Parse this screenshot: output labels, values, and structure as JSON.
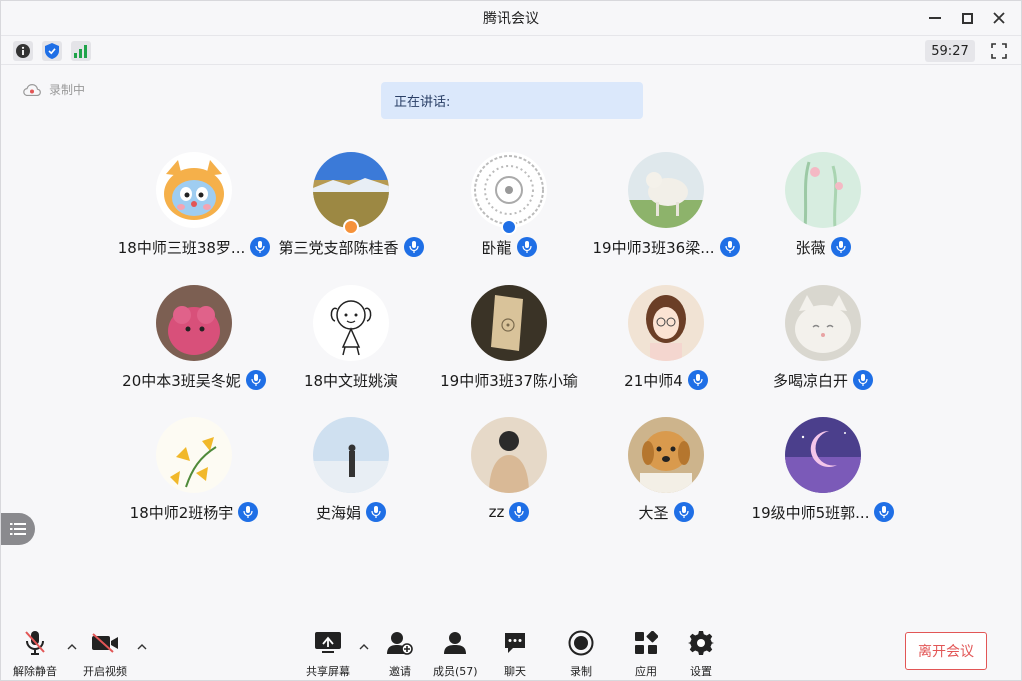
{
  "window": {
    "title": "腾讯会议"
  },
  "status": {
    "timer": "59:27",
    "icons": [
      "info-icon",
      "shield-icon",
      "signal-icon",
      "fullscreen-icon"
    ]
  },
  "recording": {
    "label": "录制中"
  },
  "speaking": {
    "label": "正在讲话:"
  },
  "participants": [
    {
      "name": "18中师三班38罗...",
      "host": false
    },
    {
      "name": "第三党支部陈桂香",
      "host": true,
      "badge_color": "#f6923a"
    },
    {
      "name": "卧龍",
      "host": true,
      "badge_color": "#1f6fe6"
    },
    {
      "name": "19中师3班36梁...",
      "host": false
    },
    {
      "name": "张薇",
      "host": false
    },
    {
      "name": "20中本3班吴冬妮",
      "host": false
    },
    {
      "name": "18中文班姚演",
      "host": false,
      "no_mic": true
    },
    {
      "name": "19中师3班37陈小瑜",
      "host": false,
      "no_mic": true
    },
    {
      "name": "21中师4",
      "host": false
    },
    {
      "name": "多喝凉白开",
      "host": false
    },
    {
      "name": "18中师2班杨宇",
      "host": false
    },
    {
      "name": "史海娟",
      "host": false
    },
    {
      "name": "zz",
      "host": false
    },
    {
      "name": "大圣",
      "host": false
    },
    {
      "name": "19级中师5班郭...",
      "host": false
    }
  ],
  "toolbar": {
    "unmute": "解除静音",
    "start_video": "开启视频",
    "share_screen": "共享屏幕",
    "invite": "邀请",
    "members": "成员(57)",
    "chat": "聊天",
    "record": "录制",
    "apps": "应用",
    "settings": "设置",
    "leave": "离开会议"
  },
  "colors": {
    "accent": "#1f6fe6",
    "leave": "#e25656",
    "speaking_bg": "#dbe8fb"
  }
}
